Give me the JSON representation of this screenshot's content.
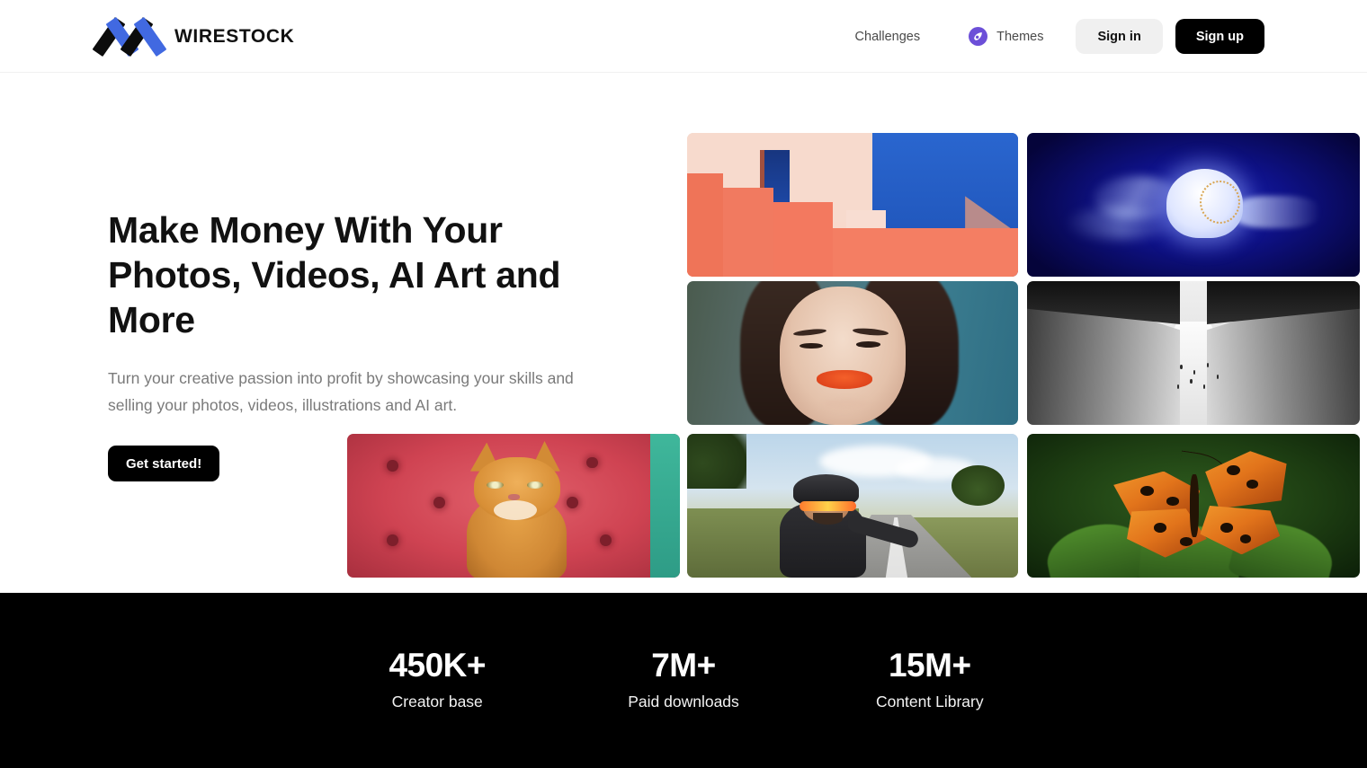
{
  "header": {
    "brand_name": "WIRESTOCK",
    "logo_icon": "wirestock-w-logo",
    "nav": {
      "challenges_label": "Challenges",
      "themes_label": "Themes",
      "themes_icon": "themes-swirl-icon",
      "signin_label": "Sign in",
      "signup_label": "Sign up"
    }
  },
  "hero": {
    "title": "Make Money With Your Photos, Videos, AI Art and More",
    "subtitle": "Turn your creative passion into profit by showcasing your skills and selling your photos, videos, illustrations and AI art.",
    "cta_label": "Get started!"
  },
  "gallery": {
    "tiles": [
      {
        "name": "architecture-stairs",
        "alt": "Pink salmon stepped architecture against blue sky with dark blue doorway"
      },
      {
        "name": "jellyfish",
        "alt": "Glowing white jellyfish drifting in deep blue water"
      },
      {
        "name": "portrait",
        "alt": "Close-up portrait of a woman with orange lipstick"
      },
      {
        "name": "corridor",
        "alt": "Black and white aerial view of a narrow corridor between buildings with birds"
      },
      {
        "name": "cat-on-couch",
        "alt": "Ginger tabby cat sitting on a tufted pink leather couch"
      },
      {
        "name": "cyclist",
        "alt": "Cyclist in helmet and orange visor riding on a countryside road"
      },
      {
        "name": "butterfly",
        "alt": "Orange comma butterfly resting on green fern leaves"
      }
    ]
  },
  "stats": {
    "items": [
      {
        "value": "450K+",
        "label": "Creator base"
      },
      {
        "value": "7M+",
        "label": "Paid downloads"
      },
      {
        "value": "15M+",
        "label": "Content Library"
      }
    ]
  },
  "colors": {
    "accent_blue": "#4169e1",
    "themes_purple": "#6c4fd8",
    "cta_black": "#000000",
    "signin_gray": "#f0f0f0",
    "body_text": "#7a7a7a"
  }
}
